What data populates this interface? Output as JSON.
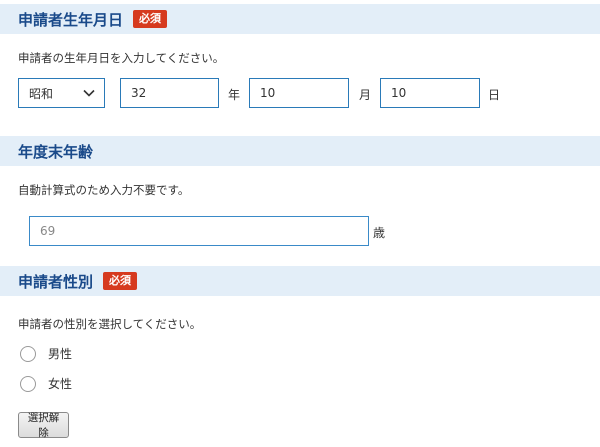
{
  "birthdate": {
    "title": "申請者生年月日",
    "badge": "必須",
    "description": "申請者の生年月日を入力してください。",
    "era_value": "昭和",
    "year_value": "32",
    "year_unit": "年",
    "month_value": "10",
    "month_unit": "月",
    "day_value": "10",
    "day_unit": "日"
  },
  "age": {
    "title": "年度末年齢",
    "description": "自動計算式のため入力不要です。",
    "value": "69",
    "unit": "歳"
  },
  "gender": {
    "title": "申請者性別",
    "badge": "必須",
    "description": "申請者の性別を選択してください。",
    "options": [
      "男性",
      "女性"
    ],
    "clear_label": "選択解除"
  },
  "colors": {
    "header_bg": "#e3eef8",
    "title_text": "#1a4a8a",
    "badge_bg": "#d63a1f",
    "field_border": "#2a7ab8"
  }
}
